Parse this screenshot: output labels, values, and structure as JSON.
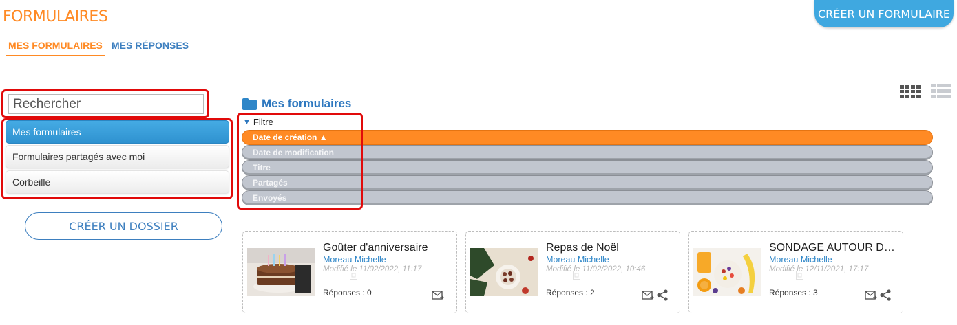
{
  "header": {
    "title": "FORMULAIRES",
    "create_form_label": "CRÉER UN FORMULAIRE"
  },
  "tabs": [
    {
      "label": "MES FORMULAIRES",
      "active": true
    },
    {
      "label": "MES RÉPONSES",
      "active": false
    }
  ],
  "view_toggle": {
    "icons": [
      "grid-view-icon",
      "list-view-icon"
    ]
  },
  "sidebar": {
    "search_placeholder": "Rechercher",
    "folders": [
      {
        "label": "Mes formulaires",
        "active": true
      },
      {
        "label": "Formulaires partagés avec moi",
        "active": false
      },
      {
        "label": "Corbeille",
        "active": false
      }
    ],
    "create_folder_label": "CRÉER UN DOSSIER"
  },
  "main": {
    "section_title": "Mes formulaires",
    "filter_label": "Filtre",
    "sort_options": [
      {
        "label": "Date de création ▲",
        "active": true
      },
      {
        "label": "Date de modification",
        "active": false
      },
      {
        "label": "Titre",
        "active": false
      },
      {
        "label": "Partagés",
        "active": false
      },
      {
        "label": "Envoyés",
        "active": false
      }
    ],
    "cards": [
      {
        "title": "Goûter d'anniversaire",
        "author": "Moreau Michelle",
        "modified": "Modifié le 11/02/2022, 11:17",
        "responses": "Réponses : 0",
        "shared": false
      },
      {
        "title": "Repas de Noël",
        "author": "Moreau Michelle",
        "modified": "Modifié le 11/02/2022, 10:46",
        "responses": "Réponses : 2",
        "shared": true
      },
      {
        "title": "SONDAGE AUTOUR DE L'ALIMENTATION",
        "author": "Moreau Michelle",
        "modified": "Modifié le 12/11/2021, 17:17",
        "responses": "Réponses : 3",
        "shared": true
      }
    ]
  },
  "colors": {
    "accent_orange": "#ff8a24",
    "accent_blue": "#3fa8e0",
    "link_blue": "#2e78bf",
    "highlight_red": "#e10a0a"
  }
}
